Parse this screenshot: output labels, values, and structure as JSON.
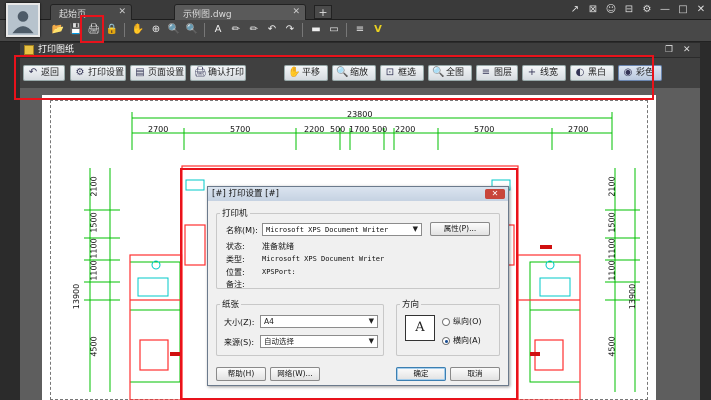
{
  "window": {
    "tabs": [
      {
        "label": "起始页"
      },
      {
        "label": "示例图.dwg"
      }
    ],
    "tab_add": "+",
    "controls": [
      "↗",
      "⊠",
      "☺",
      "⊟",
      "⚙",
      "—",
      "□",
      "✕"
    ]
  },
  "toolbar": {
    "buttons": [
      "📂",
      "💾",
      "🖨",
      "🔒",
      "✋",
      "⊕",
      "🔍",
      "🔍",
      "A",
      "✏",
      "✏",
      "↶",
      "↷",
      "▬",
      "▭",
      "≡",
      "V"
    ]
  },
  "print_window": {
    "title": "打印图纸",
    "buttons": [
      {
        "label": "返回",
        "icon": "↶"
      },
      {
        "label": "打印设置",
        "icon": "⚙"
      },
      {
        "label": "页面设置",
        "icon": "▤"
      },
      {
        "label": "确认打印",
        "icon": "🖨"
      },
      {
        "label": "平移",
        "icon": "✋"
      },
      {
        "label": "缩放",
        "icon": "🔍"
      },
      {
        "label": "框选",
        "icon": "⊡"
      },
      {
        "label": "全图",
        "icon": "🔍"
      },
      {
        "label": "图层",
        "icon": "≡"
      },
      {
        "label": "线宽",
        "icon": "+"
      },
      {
        "label": "黑白",
        "icon": "◐"
      },
      {
        "label": "彩色",
        "icon": "◉"
      }
    ]
  },
  "drawing": {
    "top_total": "23800",
    "top_dims": [
      "2700",
      "5700",
      "2200",
      "500",
      "1700",
      "500",
      "2200",
      "5700",
      "2700"
    ],
    "left_dims": [
      "2100",
      "1500",
      "1100",
      "1100",
      "4500"
    ],
    "left_total": "13900",
    "right_dims": [
      "2100",
      "1500",
      "1100",
      "1100",
      "4500"
    ],
    "right_total": "13900"
  },
  "dialog": {
    "title": "[#] 打印设置 [#]",
    "close": "✕",
    "printer_group": "打印机",
    "name_label": "名称(M):",
    "name_value": "Microsoft XPS Document Writer",
    "properties_button": "属性(P)...",
    "status_label": "状态:",
    "status_value": "准备就绪",
    "type_label": "类型:",
    "type_value": "Microsoft XPS Document Writer",
    "location_label": "位置:",
    "location_value": "XPSPort:",
    "comment_label": "备注:",
    "paper_group": "纸张",
    "size_label": "大小(Z):",
    "size_value": "A4",
    "source_label": "来源(S):",
    "source_value": "自动选择",
    "orientation_group": "方向",
    "orientation_icon": "A",
    "portrait_label": "纵向(O)",
    "landscape_label": "横向(A)",
    "help_button": "帮助(H)",
    "network_button": "网络(W)...",
    "ok_button": "确定",
    "cancel_button": "取消"
  },
  "colors": {
    "highlight_red": "#e8121b",
    "cad_green": "#00c000",
    "cad_red": "#ff3030",
    "cad_cyan": "#00c8c8"
  }
}
